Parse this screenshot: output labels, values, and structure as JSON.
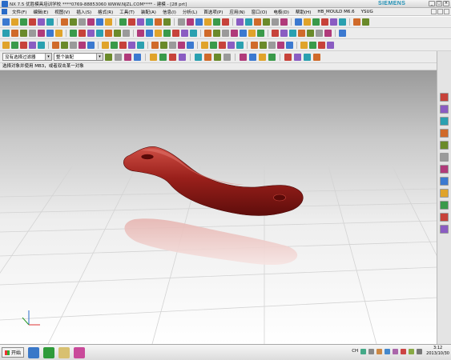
{
  "window": {
    "title": "NX 7.5 优胜模具培训学校   ****0769-88853060   WWW.NJZL.COM****  - 建模 - [28 prt]",
    "brand": "SIEMENS"
  },
  "menu": {
    "items": [
      "文件(F)",
      "编辑(E)",
      "视图(V)",
      "插入(S)",
      "格式(R)",
      "工具(T)",
      "装配(A)",
      "信息(I)",
      "分析(L)",
      "首选项(P)",
      "应用(N)",
      "窗口(O)",
      "电极(D)",
      "帮助(H)",
      "HB_MOULD M6.6",
      "YSUG"
    ]
  },
  "toolbar4": {
    "filter_value": "没有选择过滤器",
    "assembly_value": "整个装配"
  },
  "cue": {
    "text": "选择对象并使用 MB3，或者双击某一对象"
  },
  "taskbar": {
    "start_label": "开始",
    "lang": "CH",
    "time": "3:12",
    "date": "2013/10/30"
  },
  "colors": {
    "part": "#8e1a17",
    "part_highlight": "#d05248",
    "accent": "#2a6cc8"
  },
  "icons": {
    "toolbar_row1": [
      "new-file-icon",
      "open-icon",
      "save-icon",
      "undo-icon",
      "redo-icon",
      "cut-icon",
      "copy-icon",
      "paste-icon",
      "delete-icon",
      "select-icon",
      "zoom-icon",
      "rotate-icon",
      "pan-icon",
      "fit-icon",
      "shaded-icon",
      "wireframe-icon",
      "sketch-icon",
      "extrude-icon",
      "revolve-icon",
      "hole-icon",
      "boss-icon",
      "pocket-icon",
      "blend-icon",
      "chamfer-icon",
      "shell-icon",
      "trim-icon",
      "mirror-icon",
      "pattern-icon",
      "unite-icon",
      "subtract-icon",
      "intersect-icon",
      "measure-icon",
      "section-icon",
      "layer-icon",
      "render-icon",
      "analysis-icon",
      "mold-icon",
      "electrode-icon",
      "help-icon"
    ],
    "resource_bar": [
      "assembly-navigator-icon",
      "constraint-navigator-icon",
      "part-navigator-icon",
      "reuse-library-icon",
      "hd3d-icon",
      "web-browser-icon",
      "history-icon",
      "system-materials-icon",
      "process-studio-icon",
      "manufacturing-wizard-icon",
      "roles-icon",
      "system-scenes-icon"
    ]
  }
}
